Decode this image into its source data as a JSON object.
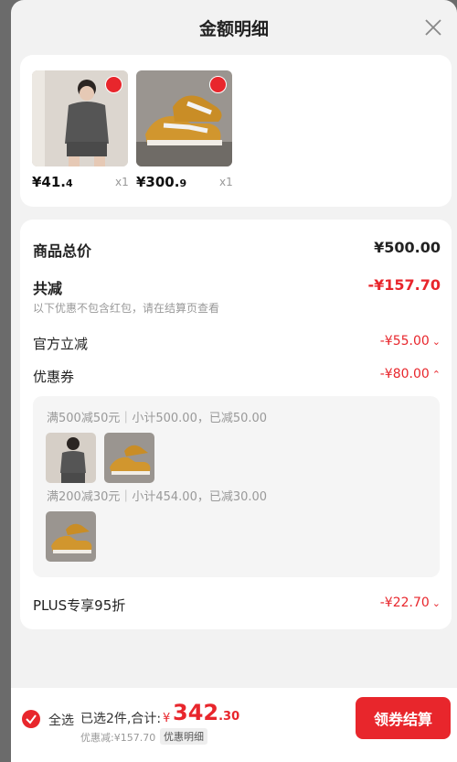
{
  "header": {
    "title": "金额明细"
  },
  "products": [
    {
      "price_int": "¥41.",
      "price_dec": "4",
      "qty": "x1"
    },
    {
      "price_int": "¥300.",
      "price_dec": "9",
      "qty": "x1"
    }
  ],
  "summary": {
    "total_label": "商品总价",
    "total_value": "¥500.00",
    "reduce_label": "共减",
    "reduce_value": "-¥157.70",
    "reduce_note": "以下优惠不包含红包，请在结算页查看",
    "official_label": "官方立减",
    "official_value": "-¥55.00",
    "coupon_label": "优惠券",
    "coupon_value": "-¥80.00",
    "coupons": [
      {
        "text": "满500减50元｜小计500.00，已减50.00"
      },
      {
        "text": "满200减30元｜小计454.00，已减30.00"
      }
    ],
    "plus_label": "PLUS专享95折",
    "plus_value": "-¥22.70"
  },
  "footer": {
    "select_all": "全选",
    "selected": "已选2件,合计:",
    "yen": "¥",
    "total_int": "342",
    "total_dec": ".30",
    "discount": "优惠减:¥157.70",
    "detail_tag": "优惠明细",
    "checkout": "领券结算"
  },
  "colors": {
    "accent": "#e8262c",
    "background": "#f2f2f2"
  }
}
